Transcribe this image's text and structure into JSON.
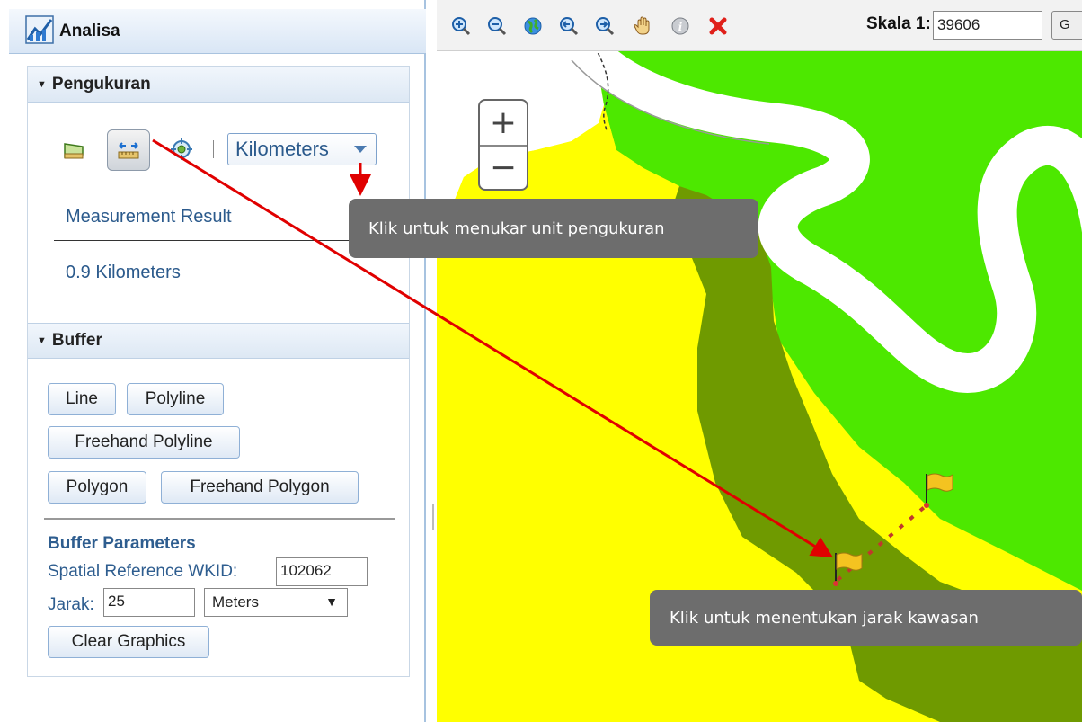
{
  "panel": {
    "title": "Analisa"
  },
  "measurement": {
    "header": "Pengukuran",
    "units_selected": "Kilometers",
    "result_label": "Measurement Result",
    "result_value": "0.9 Kilometers"
  },
  "buffer": {
    "header": "Buffer",
    "buttons": {
      "line": "Line",
      "polyline": "Polyline",
      "freehand_polyline": "Freehand Polyline",
      "polygon": "Polygon",
      "freehand_polygon": "Freehand Polygon",
      "clear_graphics": "Clear Graphics"
    },
    "params_title": "Buffer Parameters",
    "wkid_label": "Spatial Reference WKID:",
    "wkid_value": "102062",
    "jarak_label": "Jarak:",
    "jarak_value": "25",
    "jarak_unit": "Meters"
  },
  "toolbar": {
    "scale_label": "Skala 1:",
    "scale_value": "39606",
    "go_label": "G"
  },
  "map": {
    "zoom_in": "+",
    "zoom_out": "−"
  },
  "callouts": {
    "units": "Klik untuk menukar unit pengukuran",
    "distance": "Klik untuk menentukan jarak kawasan"
  },
  "colors": {
    "land_yellow": "#ffff00",
    "land_green": "#4de800",
    "land_olive": "#6f9a00",
    "river": "#ffffff",
    "annotation_red": "#e00000"
  }
}
